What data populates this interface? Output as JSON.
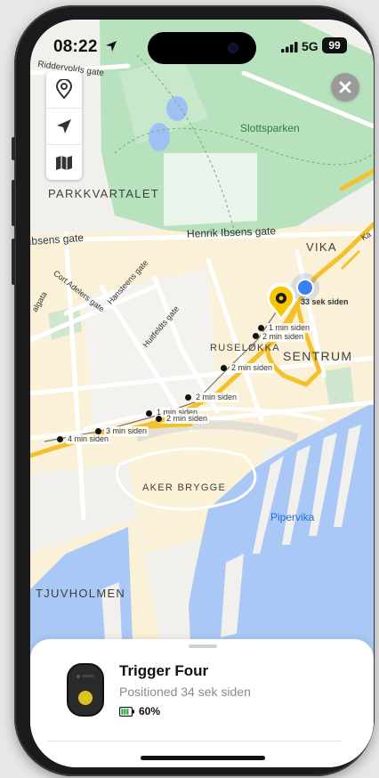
{
  "status_bar": {
    "time": "08:22",
    "network": "5G",
    "battery": "99"
  },
  "map": {
    "areas": {
      "parkkvartalet": "PARKKVARTALET",
      "vika": "VIKA",
      "sentrum": "SENTRUM",
      "ruselokka": "RUSELØKKA",
      "aker_brygge": "AKER BRYGGE",
      "tjuvholmen": "TJUVHOLMEN"
    },
    "parks": {
      "slottsparken": "Slottsparken"
    },
    "water": {
      "pipervika": "Pipervika"
    },
    "streets": {
      "riddervolds": "Riddervolds gate",
      "ibsens": "Ibsens gate",
      "henrik_ibsens": "Henrik Ibsens gate",
      "cort_adelers": "Cort Adelers gate",
      "hansteens": "Hansteens gate",
      "huitfeldts": "Huitfeldts gate",
      "algata": "algata",
      "ka": "Ka"
    },
    "trail": [
      "33 sek siden",
      "1 min siden",
      "2 min siden",
      "2 min siden",
      "2 min siden",
      "1 min siden",
      "2 min siden",
      "3 min siden",
      "4 min siden"
    ]
  },
  "device": {
    "name": "Trigger Four",
    "position": "Positioned 34 sek siden",
    "battery": "60%"
  },
  "icons": [
    "location-pin-icon",
    "navigation-arrow-icon",
    "map-icon",
    "close-icon",
    "battery-icon"
  ],
  "colors": {
    "route": "#f3c12b",
    "accent": "#f7c600",
    "park": "#b8e1bd",
    "water": "#a9c8f5",
    "user_dot": "#3b7ff0"
  }
}
